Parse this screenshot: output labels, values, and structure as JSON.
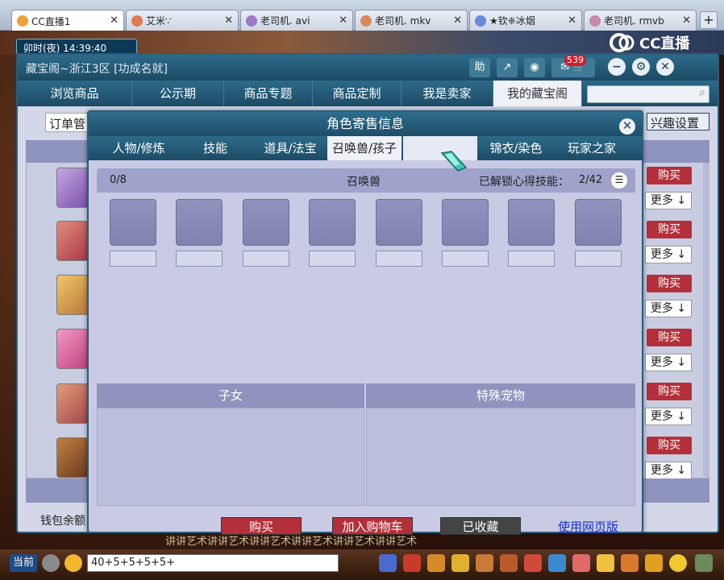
{
  "browser": {
    "tabs": [
      {
        "label": "CC直播1",
        "active": true
      },
      {
        "label": "艾米∵",
        "active": false
      },
      {
        "label": "老司机. avi",
        "active": false
      },
      {
        "label": "老司机. mkv",
        "active": false
      },
      {
        "label": "★钦❈冰烟",
        "active": false
      },
      {
        "label": "老司机. rmvb",
        "active": false
      }
    ],
    "new_tab": "+"
  },
  "game": {
    "clock": "卯时(夜) 14:39:40",
    "stream_brand": "CC直播"
  },
  "main_window": {
    "title": "藏宝阁~浙江3区 [功成名就]",
    "help_label": "助",
    "notification_count": "539",
    "nav": [
      {
        "label": "浏览商品",
        "active": false
      },
      {
        "label": "公示期",
        "active": false
      },
      {
        "label": "商品专题",
        "active": false
      },
      {
        "label": "商品定制",
        "active": false
      },
      {
        "label": "我是卖家",
        "active": false
      },
      {
        "label": "我的藏宝阁",
        "active": true
      }
    ],
    "search": {
      "placeholder": "",
      "value": ""
    },
    "order_label": "订单管",
    "interest_label": "兴趣设置",
    "buy_label": "购买",
    "more_label": "更多 ↓",
    "wallet_label": "钱包余额"
  },
  "dialog": {
    "title": "角色寄售信息",
    "close": "✕",
    "tabs": [
      {
        "label": "人物/修炼",
        "active": false
      },
      {
        "label": "技能",
        "active": false
      },
      {
        "label": "道具/法宝",
        "active": false
      },
      {
        "label": "召唤兽/孩子",
        "active": true
      },
      {
        "label": "",
        "active": false
      },
      {
        "label": "锦衣/染色",
        "active": false
      },
      {
        "label": "玩家之家",
        "active": false
      }
    ],
    "pets": {
      "count": "0/8",
      "title": "召唤兽",
      "skills_label": "已解锁心得技能：",
      "skills_value": "2/42",
      "slot_count": 8
    },
    "children_title": "子女",
    "special_pets_title": "特殊宠物",
    "buttons": {
      "buy": "购买",
      "add_cart": "加入购物车",
      "favorited": "已收藏",
      "web": "使用网页版"
    }
  },
  "bottom": {
    "current_channel": "当前",
    "chat_input": "40+5+5+5+5+",
    "marquee": "讲讲艺术讲讲艺术讲讲艺术讲讲艺术讲讲艺术讲讲艺术"
  },
  "colors": {
    "title_bar": "#1e4d68",
    "buy_red": "#b3303a",
    "panel_lilac": "#c8cbe3",
    "header_lilac": "#8f93be"
  }
}
